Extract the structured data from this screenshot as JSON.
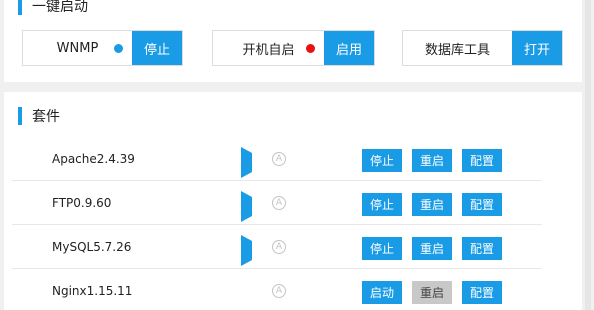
{
  "quick_start": {
    "title": "一键启动",
    "items": [
      {
        "label": "WNMP",
        "button": "停止",
        "status_color": "#1a9be6"
      },
      {
        "label": "开机自启",
        "button": "启用",
        "status_color": "#e81010"
      },
      {
        "label": "数据库工具",
        "button": "打开"
      }
    ]
  },
  "packages": {
    "title": "套件",
    "auto_icon_glyph": "A",
    "rows": [
      {
        "name": "Apache2.4.39",
        "state": "running",
        "buttons": [
          "停止",
          "重启",
          "配置"
        ]
      },
      {
        "name": "FTP0.9.60",
        "state": "running",
        "buttons": [
          "停止",
          "重启",
          "配置"
        ]
      },
      {
        "name": "MySQL5.7.26",
        "state": "running",
        "buttons": [
          "停止",
          "重启",
          "配置"
        ]
      },
      {
        "name": "Nginx1.15.11",
        "state": "stopped",
        "buttons": [
          "启动",
          "重启",
          "配置"
        ],
        "restart_disabled": true
      }
    ]
  },
  "colors": {
    "accent": "#1a9be6",
    "stopped": "#e23b3b",
    "disabled": "#c8c8c8"
  }
}
